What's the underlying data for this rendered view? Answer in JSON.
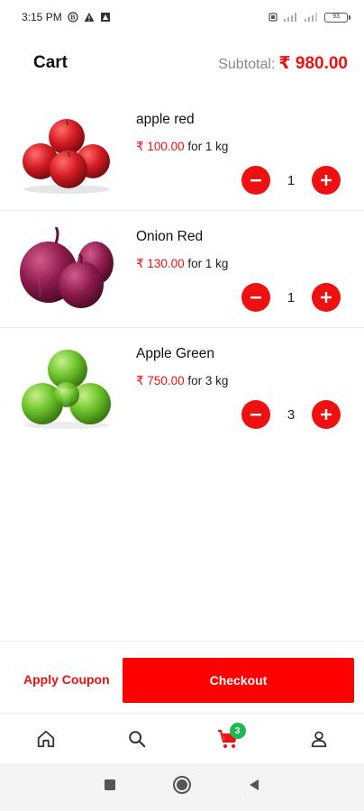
{
  "status_bar": {
    "time": "3:15 PM",
    "battery": "93",
    "icons": [
      "circle-b-icon",
      "warning-icon",
      "shield-icon",
      "vibrate-icon",
      "signal-icon",
      "signal-icon",
      "battery-icon"
    ]
  },
  "header": {
    "title": "Cart",
    "subtotal_label": "Subtotal:",
    "subtotal_value": "₹ 980.00"
  },
  "cart": {
    "items": [
      {
        "name": "apple red",
        "price": "₹ 100.00",
        "unit": "for 1 kg",
        "qty": "1",
        "image": "red-apples"
      },
      {
        "name": "Onion Red",
        "price": "₹ 130.00",
        "unit": "for 1 kg",
        "qty": "1",
        "image": "red-onions"
      },
      {
        "name": "Apple Green",
        "price": "₹ 750.00",
        "unit": "for 3 kg",
        "qty": "3",
        "image": "green-apples"
      }
    ]
  },
  "actions": {
    "coupon_label": "Apply Coupon",
    "checkout_label": "Checkout"
  },
  "nav": {
    "items": [
      {
        "icon": "home-icon"
      },
      {
        "icon": "search-icon"
      },
      {
        "icon": "cart-icon",
        "badge": "3"
      },
      {
        "icon": "profile-icon"
      }
    ]
  },
  "colors": {
    "accent": "#ee1111",
    "checkout": "#ff0000",
    "badge": "#1db954",
    "muted": "#888888"
  }
}
